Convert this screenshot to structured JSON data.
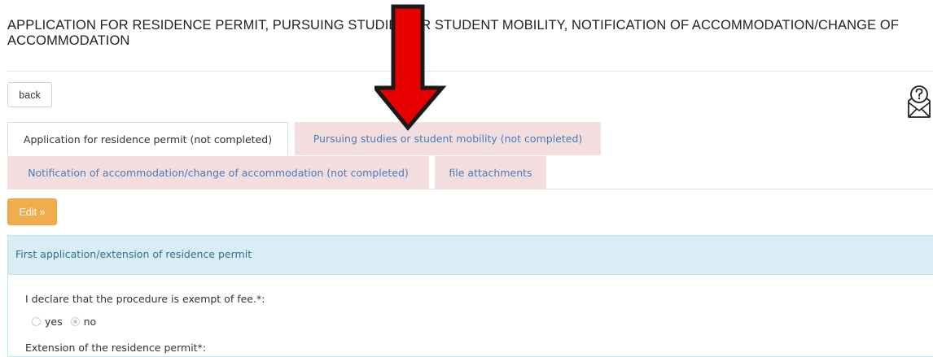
{
  "page": {
    "title": "APPLICATION FOR RESIDENCE PERMIT, PURSUING STUDIES OR STUDENT MOBILITY, NOTIFICATION OF ACCOMMODATION/CHANGE OF ACCOMMODATION"
  },
  "toolbar": {
    "back_label": "back",
    "help_icon": "help-envelope-icon"
  },
  "tabs": [
    {
      "label": "Application for residence permit (not completed)",
      "active": true
    },
    {
      "label": "Pursuing studies or student mobility (not completed)",
      "active": false
    },
    {
      "label": "Notification of accommodation/change of accommodation (not completed)",
      "active": false
    },
    {
      "label": "file attachments",
      "active": false
    }
  ],
  "actions": {
    "edit_label": "Edit »"
  },
  "panel": {
    "heading": "First application/extension of residence permit",
    "question_fee": "I declare that the procedure is exempt of fee.*:",
    "options": [
      {
        "label": "yes",
        "checked": false
      },
      {
        "label": "no",
        "checked": true
      }
    ],
    "question_extension": "Extension of the residence permit*:"
  },
  "colors": {
    "arrow_red": "#e60000",
    "tab_inactive_bg": "#f2dede",
    "edit_button": "#f0ad4e",
    "panel_heading_bg": "#d9edf7"
  }
}
